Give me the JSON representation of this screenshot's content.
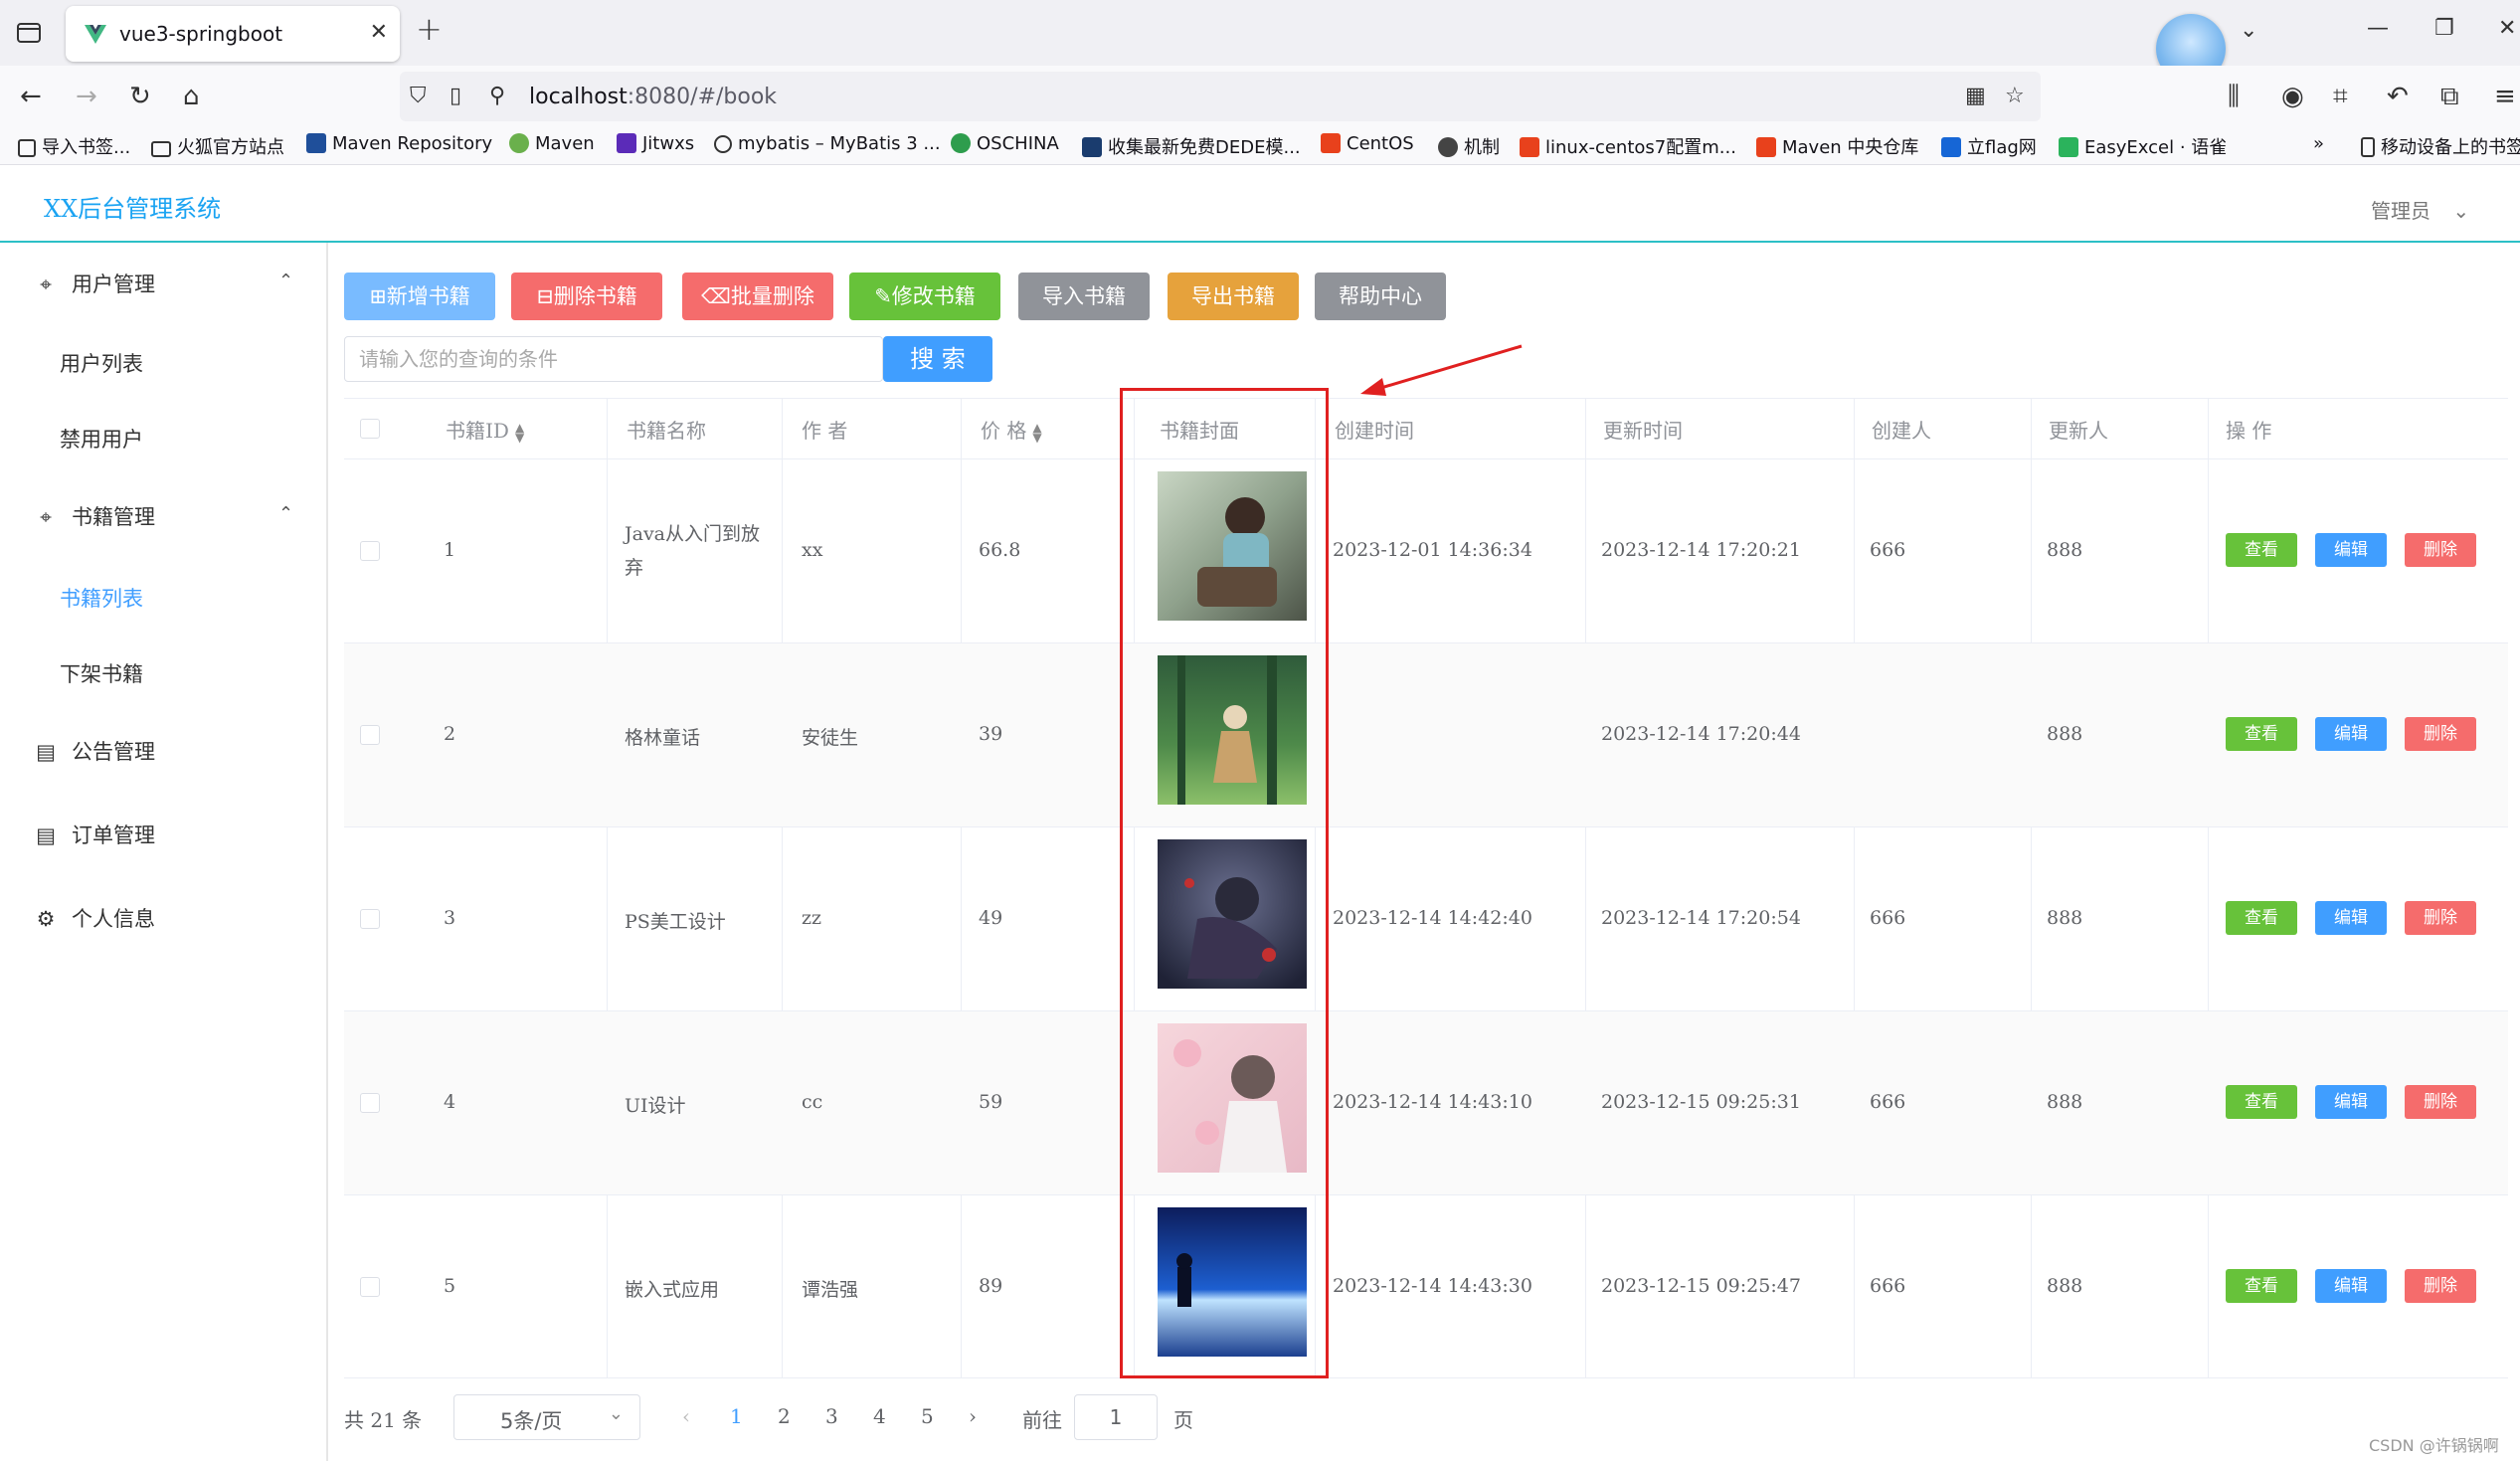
{
  "browser": {
    "tab_title": "vue3-springboot",
    "url_host": "localhost",
    "url_rest": ":8080/#/book",
    "bookmarks": [
      "导入书签...",
      "火狐官方站点",
      "Maven Repository",
      "Maven",
      "Jitwxs",
      "mybatis – MyBatis 3 ...",
      "OSCHINA",
      "收集最新免费DEDE模...",
      "CentOS",
      "机制",
      "linux-centos7配置m...",
      "Maven 中央仓库",
      "立flag网",
      "EasyExcel · 语雀",
      "移动设备上的书签"
    ]
  },
  "app": {
    "title": "XX后台管理系统",
    "admin_label": "管理员"
  },
  "sidebar": {
    "groups": [
      {
        "label": "用户管理",
        "icon": "location-pin-icon"
      },
      {
        "label": "书籍管理",
        "icon": "location-pin-icon"
      },
      {
        "label": "公告管理",
        "icon": "document-icon"
      },
      {
        "label": "订单管理",
        "icon": "document-icon"
      },
      {
        "label": "个人信息",
        "icon": "gear-icon"
      }
    ],
    "items": [
      "用户列表",
      "禁用用户",
      "书籍列表",
      "下架书籍"
    ]
  },
  "toolbar": {
    "buttons": [
      {
        "label": "新增书籍",
        "color": "#79bbff"
      },
      {
        "label": "删除书籍",
        "color": "#f56c6c"
      },
      {
        "label": "批量删除",
        "color": "#f56c6c"
      },
      {
        "label": "修改书籍",
        "color": "#67c23a"
      },
      {
        "label": "导入书籍",
        "color": "#909399"
      },
      {
        "label": "导出书籍",
        "color": "#e6a23c"
      },
      {
        "label": "帮助中心",
        "color": "#909399"
      }
    ],
    "search_placeholder": "请输入您的查询的条件",
    "search_button": "搜 索"
  },
  "table": {
    "headers": [
      "书籍ID",
      "书籍名称",
      "作 者",
      "价 格",
      "书籍封面",
      "创建时间",
      "更新时间",
      "创建人",
      "更新人",
      "操 作"
    ],
    "rows": [
      {
        "id": "1",
        "name": "Java从入门到放弃",
        "author": "xx",
        "price": "66.8",
        "created": "2023-12-01 14:36:34",
        "updated": "2023-12-14 17:20:21",
        "creator": "666",
        "updater": "888"
      },
      {
        "id": "2",
        "name": "格林童话",
        "author": "安徒生",
        "price": "39",
        "created": "",
        "updated": "2023-12-14 17:20:44",
        "creator": "",
        "updater": "888"
      },
      {
        "id": "3",
        "name": "PS美工设计",
        "author": "zz",
        "price": "49",
        "created": "2023-12-14 14:42:40",
        "updated": "2023-12-14 17:20:54",
        "creator": "666",
        "updater": "888"
      },
      {
        "id": "4",
        "name": "UI设计",
        "author": "cc",
        "price": "59",
        "created": "2023-12-14 14:43:10",
        "updated": "2023-12-15 09:25:31",
        "creator": "666",
        "updater": "888"
      },
      {
        "id": "5",
        "name": "嵌入式应用",
        "author": "谭浩强",
        "price": "89",
        "created": "2023-12-14 14:43:30",
        "updated": "2023-12-15 09:25:47",
        "creator": "666",
        "updater": "888"
      }
    ],
    "actions": {
      "view": "查看",
      "edit": "编辑",
      "delete": "删除"
    }
  },
  "pagination": {
    "total": "共 21 条",
    "page_size": "5条/页",
    "pages": [
      "1",
      "2",
      "3",
      "4",
      "5"
    ],
    "current_page": "1",
    "goto_label": "前往",
    "goto_value": "1",
    "page_suffix": "页"
  },
  "watermark": "CSDN @许锅锅啊",
  "colors": {
    "primary": "#409eff",
    "success": "#67c23a",
    "danger": "#f56c6c",
    "annotation": "#e02020"
  }
}
